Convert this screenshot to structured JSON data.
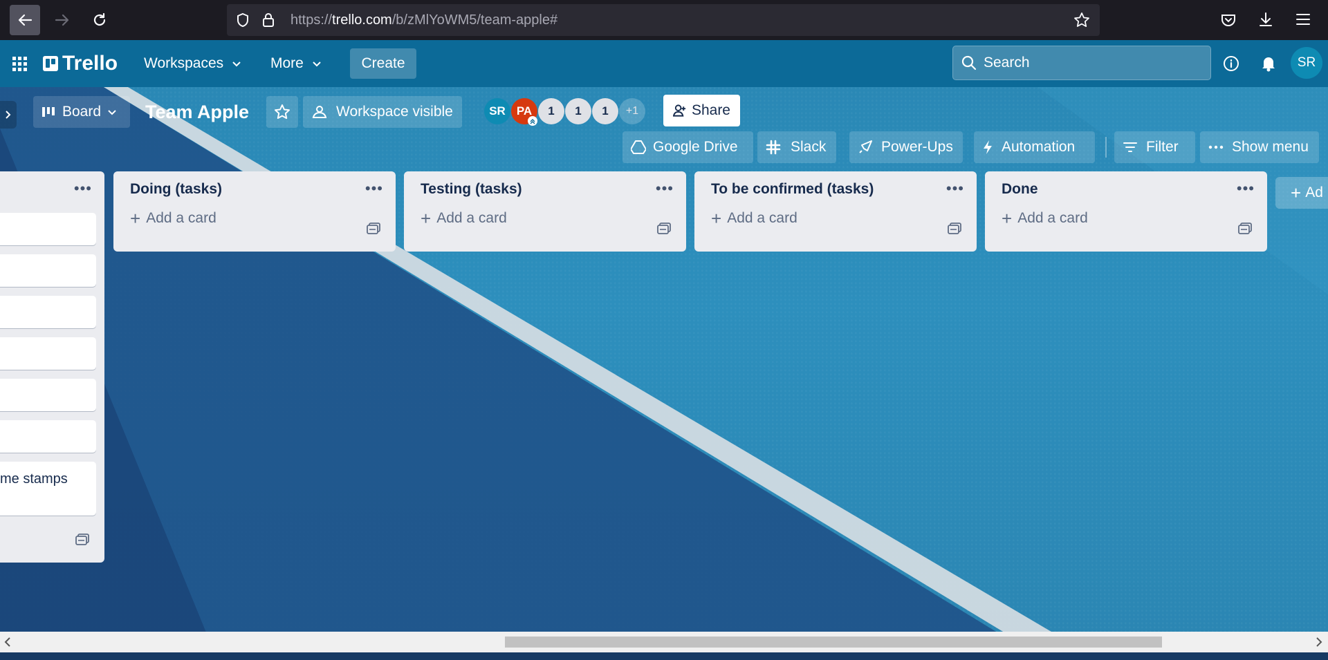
{
  "browser": {
    "url_prefix": "https://",
    "url_domain": "trello.com",
    "url_path": "/b/zMlYoWM5/team-apple#"
  },
  "header": {
    "logo_text": "Trello",
    "workspaces_label": "Workspaces",
    "more_label": "More",
    "create_label": "Create",
    "search_placeholder": "Search",
    "user_initials": "SR"
  },
  "board": {
    "view_label": "Board",
    "title": "Team Apple",
    "visibility_label": "Workspace visible",
    "members": [
      {
        "initials": "SR",
        "color": "#0e8bb3"
      },
      {
        "initials": "PA",
        "color": "#d6390f"
      },
      {
        "initials": "1",
        "color": "#dfe1e6"
      },
      {
        "initials": "1",
        "color": "#dfe1e6"
      },
      {
        "initials": "1",
        "color": "#dfe1e6"
      }
    ],
    "members_overflow": "+1",
    "share_label": "Share",
    "powerups": {
      "google_drive": "Google Drive",
      "slack": "Slack",
      "power_ups": "Power-Ups",
      "automation": "Automation",
      "filter": "Filter",
      "show_menu": "Show menu"
    },
    "add_list_label": "Ad"
  },
  "lists": [
    {
      "title": "",
      "add_card": "",
      "partial_card_text": "me stamps"
    },
    {
      "title": "Doing (tasks)",
      "add_card": "Add a card"
    },
    {
      "title": "Testing (tasks)",
      "add_card": "Add a card"
    },
    {
      "title": "To be confirmed (tasks)",
      "add_card": "Add a card"
    },
    {
      "title": "Done",
      "add_card": "Add a card"
    }
  ],
  "colors": {
    "header_bg": "#0c6a98",
    "list_bg": "#ebecf0",
    "title_text": "#172b4d"
  }
}
